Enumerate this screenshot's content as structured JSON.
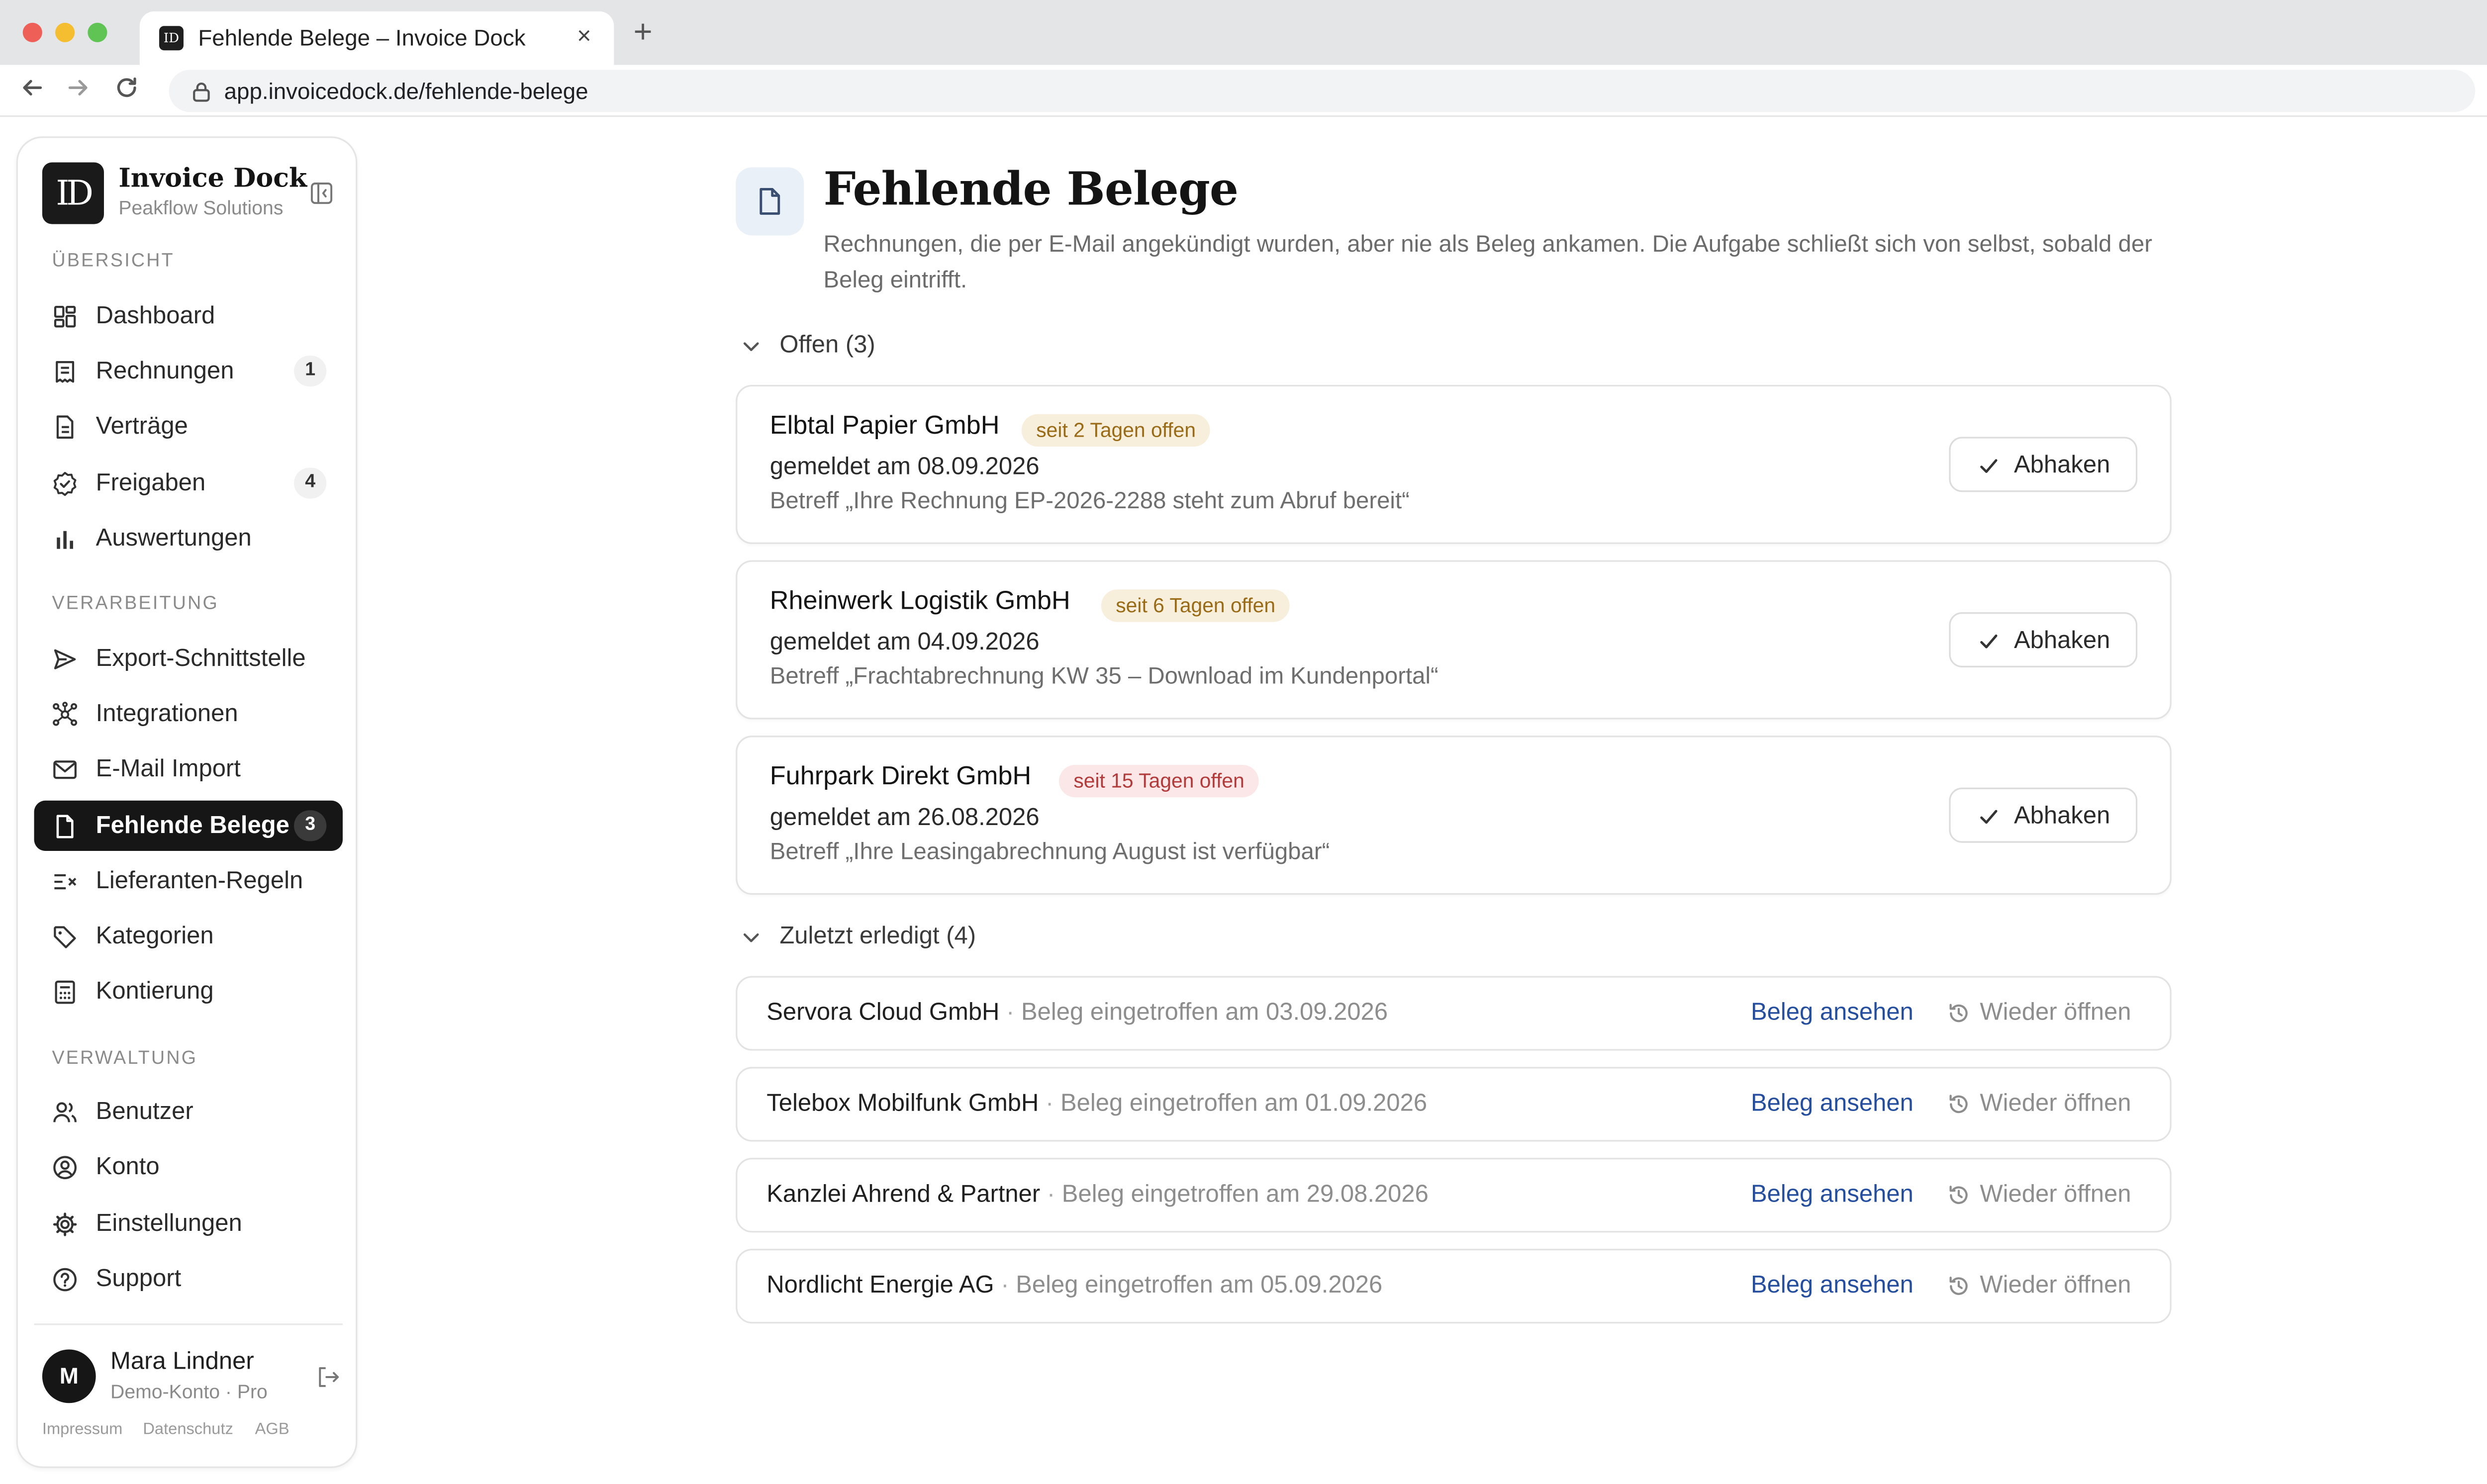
{
  "browser": {
    "tab_title": "Fehlende Belege – Invoice Dock",
    "tab_favicon": "ID",
    "url": "app.invoicedock.de/fehlende-belege",
    "close_glyph": "×",
    "new_tab_glyph": "+"
  },
  "app": {
    "logo_text": "ID",
    "name": "Invoice Dock",
    "org": "Peakflow Solutions"
  },
  "sidebar": {
    "sections": [
      {
        "label": "ÜBERSICHT",
        "items": [
          {
            "label": "Dashboard",
            "icon": "dashboard-icon",
            "count": ""
          },
          {
            "label": "Rechnungen",
            "icon": "invoice-icon",
            "count": "1"
          },
          {
            "label": "Verträge",
            "icon": "document-icon",
            "count": ""
          },
          {
            "label": "Freigaben",
            "icon": "badge-check-icon",
            "count": "4"
          },
          {
            "label": "Auswertungen",
            "icon": "bar-chart-icon",
            "count": ""
          }
        ]
      },
      {
        "label": "VERARBEITUNG",
        "items": [
          {
            "label": "Export-Schnittstelle",
            "icon": "send-icon",
            "count": ""
          },
          {
            "label": "Integrationen",
            "icon": "network-icon",
            "count": ""
          },
          {
            "label": "E-Mail Import",
            "icon": "mail-icon",
            "count": ""
          },
          {
            "label": "Fehlende Belege",
            "icon": "file-icon",
            "count": "3",
            "active": true
          },
          {
            "label": "Lieferanten-Regeln",
            "icon": "rules-icon",
            "count": ""
          },
          {
            "label": "Kategorien",
            "icon": "tag-icon",
            "count": ""
          },
          {
            "label": "Kontierung",
            "icon": "calculator-icon",
            "count": ""
          }
        ]
      },
      {
        "label": "VERWALTUNG",
        "items": [
          {
            "label": "Benutzer",
            "icon": "users-icon",
            "count": ""
          },
          {
            "label": "Konto",
            "icon": "account-icon",
            "count": ""
          },
          {
            "label": "Einstellungen",
            "icon": "gear-icon",
            "count": ""
          },
          {
            "label": "Support",
            "icon": "help-icon",
            "count": ""
          }
        ]
      }
    ],
    "user": {
      "initial": "M",
      "name": "Mara Lindner",
      "plan": "Demo-Konto · Pro"
    },
    "footer_links": [
      "Impressum",
      "Datenschutz",
      "AGB"
    ]
  },
  "page": {
    "title": "Fehlende Belege",
    "description": "Rechnungen, die per E-Mail angekündigt wurden, aber nie als Beleg ankamen. Die Aufgabe schließt sich von selbst, sobald der Beleg eintrifft.",
    "open_group_label": "Offen (3)",
    "done_group_label": "Zuletzt erledigt (4)",
    "check_label": "Abhaken",
    "view_label": "Beleg ansehen",
    "reopen_label": "Wieder öffnen",
    "open_items": [
      {
        "vendor": "Elbtal Papier GmbH",
        "badge": "seit 2 Tagen offen",
        "badge_tone": "amber",
        "date": "gemeldet am 08.09.2026",
        "subject": "Betreff „Ihre Rechnung EP-2026-2288 steht zum Abruf bereit“"
      },
      {
        "vendor": "Rheinwerk Logistik GmbH",
        "badge": "seit 6 Tagen offen",
        "badge_tone": "amber",
        "date": "gemeldet am 04.09.2026",
        "subject": "Betreff „Frachtabrechnung KW 35 – Download im Kundenportal“"
      },
      {
        "vendor": "Fuhrpark Direkt GmbH",
        "badge": "seit 15 Tagen offen",
        "badge_tone": "red",
        "date": "gemeldet am 26.08.2026",
        "subject": "Betreff „Ihre Leasingabrechnung August ist verfügbar“"
      }
    ],
    "done_items": [
      {
        "vendor": "Servora Cloud GmbH",
        "separator": " · ",
        "note": "Beleg eingetroffen am 03.09.2026"
      },
      {
        "vendor": "Telebox Mobilfunk GmbH",
        "separator": " · ",
        "note": "Beleg eingetroffen am 01.09.2026"
      },
      {
        "vendor": "Kanzlei Ahrend & Partner",
        "separator": " · ",
        "note": "Beleg eingetroffen am 29.08.2026"
      },
      {
        "vendor": "Nordlicht Energie AG",
        "separator": " · ",
        "note": "Beleg eingetroffen am 05.09.2026"
      }
    ]
  },
  "colors": {
    "accent_dark": "#161616",
    "link_blue": "#254f9e",
    "badge_amber_bg": "#f7eedb",
    "badge_amber_text": "#9a6b16",
    "badge_red_bg": "#fbe7e7",
    "badge_red_text": "#b33a3a"
  }
}
